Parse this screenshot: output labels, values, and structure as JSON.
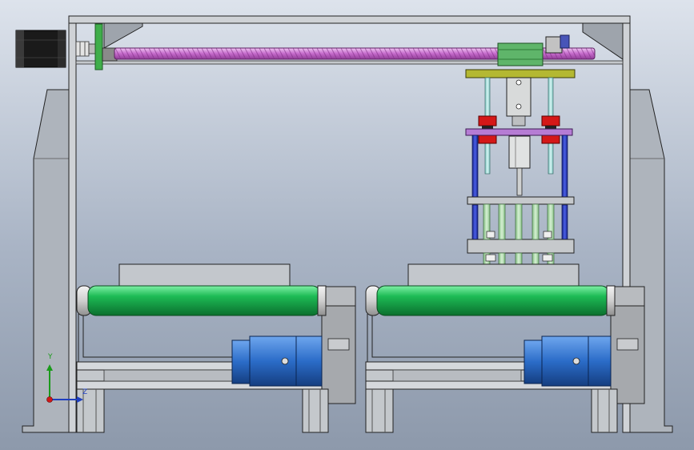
{
  "viewport": {
    "view": "front",
    "background_top": "#dde3ec",
    "background_bottom": "#8d99ab"
  },
  "triad": {
    "y_label": "Y",
    "z_label": "Z",
    "y_color": "#1a9a1a",
    "z_color": "#1f3fbf",
    "origin_color": "#d01818"
  },
  "colors": {
    "frame_fill": "#cfd2d6",
    "frame_stroke": "#222222",
    "pillar_fill": "#aeb4bc",
    "motor_body": "#1a1a1a",
    "coupling": "#d8d8d8",
    "end_plate": "#3fae4a",
    "leadscrew": "#cf7fd4",
    "slider_block": "#5fb56a",
    "bracket": "#b8b8b8",
    "bearing_blue": "#4855b8",
    "top_plate": "#b4b832",
    "guide_rod": "#a6dedb",
    "cylinder": "#d8dada",
    "linear_bearing_red": "#d41818",
    "mid_plate": "#b67cd4",
    "blue_rod": "#2c3fc8",
    "spring_rod": "#a9d8a7",
    "gray_plate": "#c6c9cc",
    "roller_green": "#1dbb55",
    "roller_cap": "#dcdcdc",
    "gearbox": "#a6a9ad",
    "servo_blue": "#2b6cc8",
    "rail": "#d5d8dc"
  }
}
